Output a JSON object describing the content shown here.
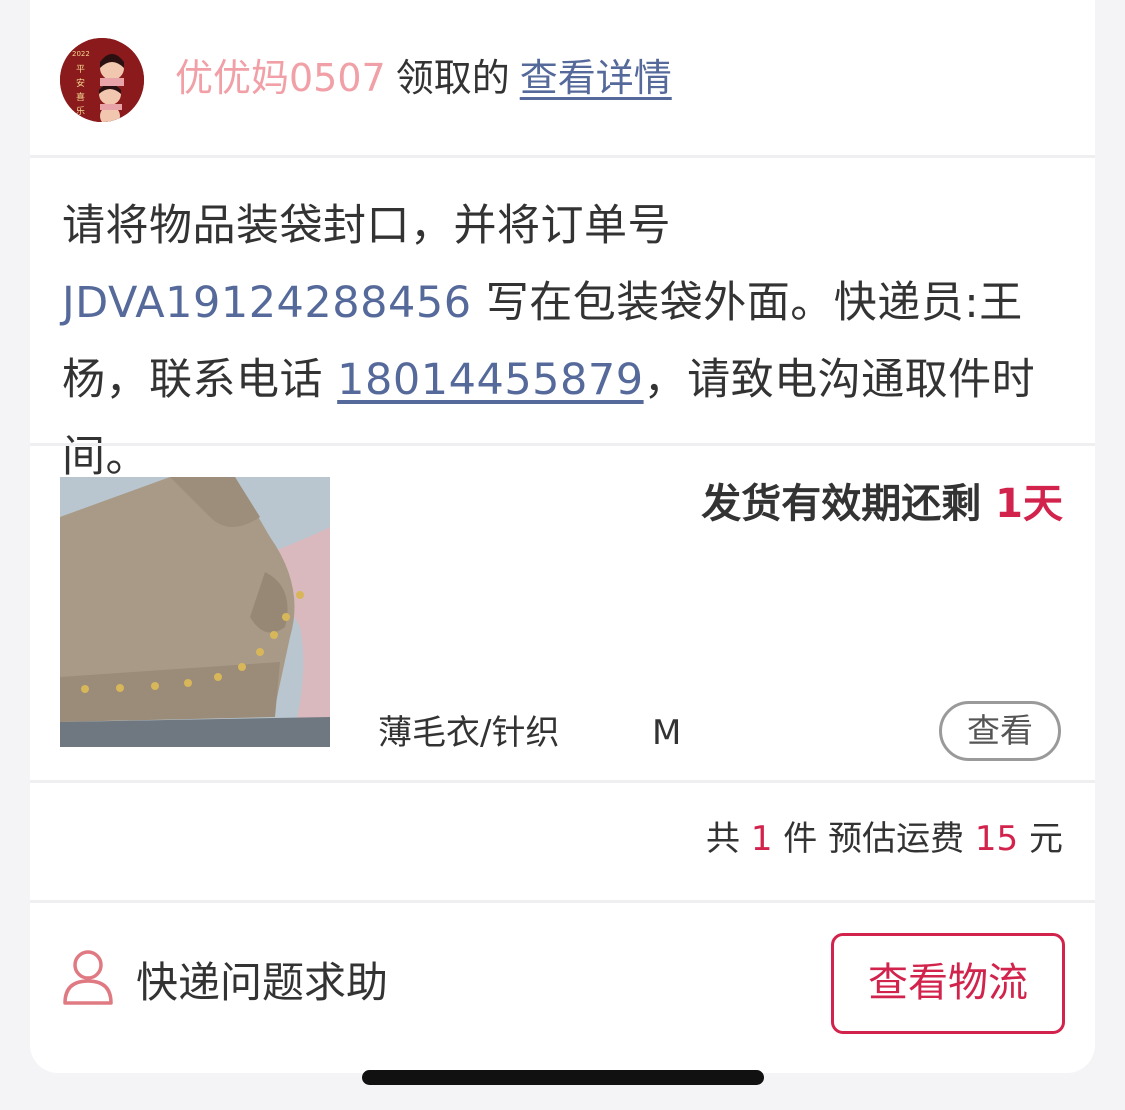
{
  "header": {
    "user_name": "优优妈0507",
    "received_text": "领取的",
    "detail_link": "查看详情",
    "avatar_text": "2022 平安喜乐"
  },
  "instruction": {
    "part1": "请将物品装袋封口，并将订单号 ",
    "order_no": "JDVA19124288456",
    "part2": " 写在包装袋外面。快递员:王杨，联系电话 ",
    "phone": "18014455879",
    "part3": "，请致电沟通取件时间。"
  },
  "product": {
    "deadline_label": "发货有效期还剩 ",
    "deadline_value": "1天",
    "category": "薄毛衣/针织",
    "size": "M",
    "view_button": "查看"
  },
  "summary": {
    "prefix": "共 ",
    "count": "1",
    "middle": " 件 预估运费 ",
    "fee": "15",
    "suffix": " 元"
  },
  "footer": {
    "help_label": "快递问题求助",
    "logistics_button": "查看物流"
  },
  "colors": {
    "accent": "#d2234c",
    "link": "#55699a",
    "username": "#f0a0a6",
    "text": "#333333"
  },
  "icons": [
    "person-icon"
  ]
}
